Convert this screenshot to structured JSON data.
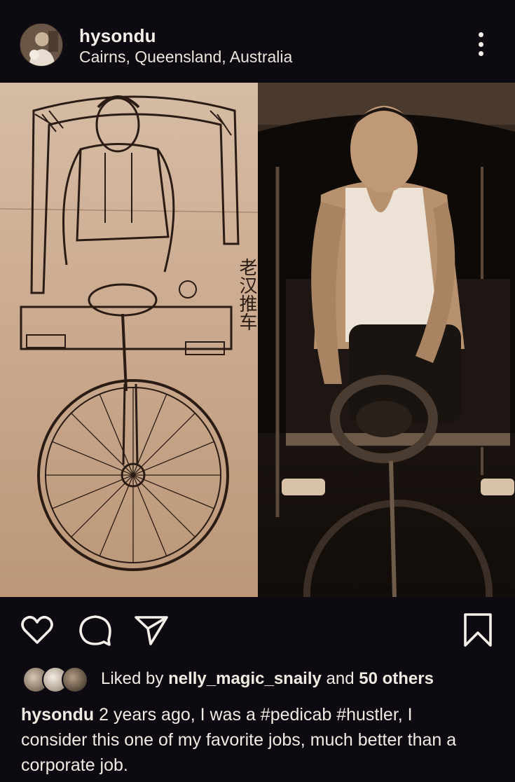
{
  "post": {
    "username": "hysondu",
    "location": "Cairns, Queensland, Australia",
    "image_alt_left": "Sketch of a pedicab rider",
    "image_alt_right": "Photo of a smiling pedicab rider",
    "drawing_caption": "老汉推车"
  },
  "icons": {
    "more": "more-vertical-icon",
    "like": "heart-icon",
    "comment": "comment-icon",
    "share": "share-icon",
    "save": "bookmark-icon"
  },
  "likes": {
    "prefix": "Liked by ",
    "user": "nelly_magic_snaily",
    "middle": " and ",
    "others": "50 others"
  },
  "caption": {
    "username": "hysondu",
    "text": " 2 years ago, I was a #pedicab #hustler, I consider this one of my favorite jobs, much better than a corporate job."
  },
  "colors": {
    "background": "#0d0a12",
    "text": "#f2ede6"
  }
}
